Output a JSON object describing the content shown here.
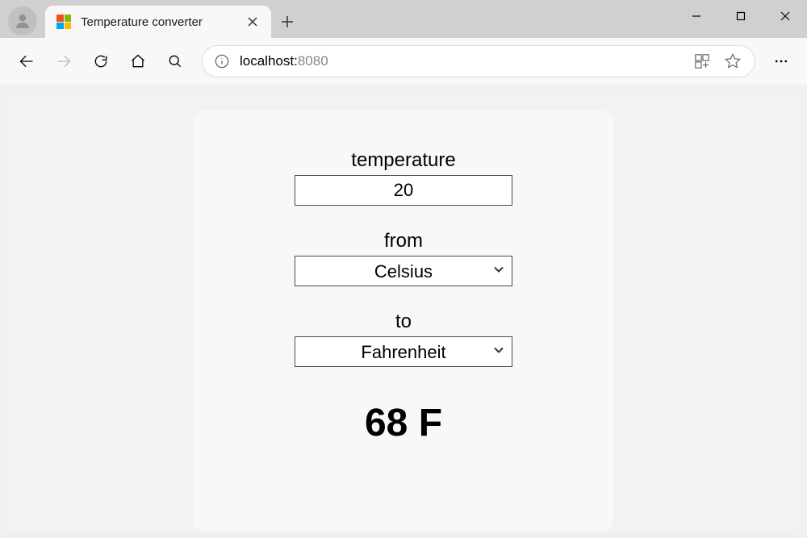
{
  "browser": {
    "tab": {
      "title": "Temperature converter"
    },
    "url": {
      "host": "localhost:",
      "port": "8080"
    }
  },
  "converter": {
    "temperature": {
      "label": "temperature",
      "value": "20"
    },
    "from": {
      "label": "from",
      "selected": "Celsius"
    },
    "to": {
      "label": "to",
      "selected": "Fahrenheit"
    },
    "result": "68 F"
  }
}
